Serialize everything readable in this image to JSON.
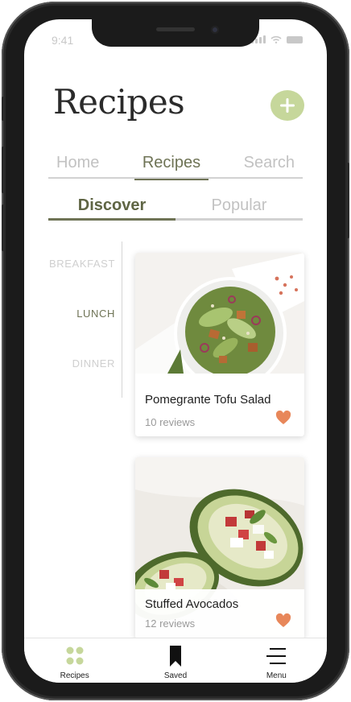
{
  "status": {
    "time": "9:41"
  },
  "header": {
    "title": "Recipes",
    "add_icon": "plus-icon"
  },
  "tabs": [
    {
      "label": "Home",
      "active": false
    },
    {
      "label": "Recipes",
      "active": true
    },
    {
      "label": "Search",
      "active": false
    }
  ],
  "subtabs": [
    {
      "label": "Discover",
      "active": true
    },
    {
      "label": "Popular",
      "active": false
    }
  ],
  "meals": [
    {
      "label": "BREAKFAST",
      "active": false
    },
    {
      "label": "LUNCH",
      "active": true
    },
    {
      "label": "DINNER",
      "active": false
    }
  ],
  "cards": [
    {
      "name": "Pomegrante Tofu Salad",
      "reviews": "10 reviews",
      "icon": "heart-icon"
    },
    {
      "name": "Stuffed Avocados",
      "reviews": "12 reviews",
      "icon": "heart-icon"
    }
  ],
  "bottom_nav": [
    {
      "label": "Recipes",
      "icon": "grid-dots-icon"
    },
    {
      "label": "Saved",
      "icon": "bookmark-icon"
    },
    {
      "label": "Menu",
      "icon": "menu-icon"
    }
  ],
  "colors": {
    "accent": "#6e7355",
    "add_button": "#c6d79b",
    "heart": "#e8875a",
    "inactive_text": "#c2c2c2"
  }
}
